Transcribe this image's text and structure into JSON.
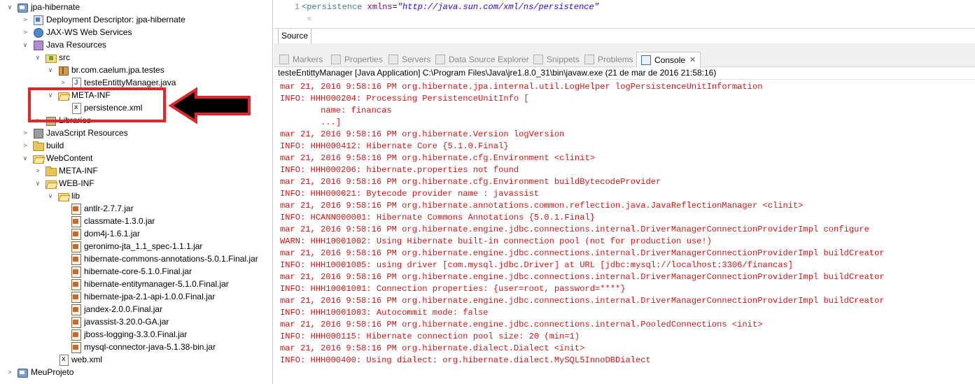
{
  "explorer": {
    "items": [
      {
        "label": "jpa-hibernate",
        "twisty": "v",
        "icon": "project"
      },
      {
        "label": "Deployment Descriptor: jpa-hibernate",
        "twisty": ">",
        "icon": "descriptor"
      },
      {
        "label": "JAX-WS Web Services",
        "twisty": ">",
        "icon": "ws"
      },
      {
        "label": "Java Resources",
        "twisty": "v",
        "icon": "jres"
      },
      {
        "label": "src",
        "twisty": "v",
        "icon": "srcfolder"
      },
      {
        "label": "br.com.caelum.jpa.testes",
        "twisty": "v",
        "icon": "pkg"
      },
      {
        "label": "testeEntittyManager.java",
        "twisty": ">",
        "icon": "javafile"
      },
      {
        "label": "META-INF",
        "twisty": "v",
        "icon": "folderopen"
      },
      {
        "label": "persistence.xml",
        "twisty": "",
        "icon": "xmlfile"
      },
      {
        "label": "Libraries",
        "twisty": ">",
        "icon": "lib"
      },
      {
        "label": "JavaScript Resources",
        "twisty": ">",
        "icon": "jsres"
      },
      {
        "label": "build",
        "twisty": ">",
        "icon": "folder"
      },
      {
        "label": "WebContent",
        "twisty": "v",
        "icon": "folderopen"
      },
      {
        "label": "META-INF",
        "twisty": ">",
        "icon": "folder"
      },
      {
        "label": "WEB-INF",
        "twisty": "v",
        "icon": "folderopen"
      },
      {
        "label": "lib",
        "twisty": "v",
        "icon": "folderopen"
      },
      {
        "label": "antlr-2.7.7.jar",
        "twisty": "",
        "icon": "jar"
      },
      {
        "label": "classmate-1.3.0.jar",
        "twisty": "",
        "icon": "jar"
      },
      {
        "label": "dom4j-1.6.1.jar",
        "twisty": "",
        "icon": "jar"
      },
      {
        "label": "geronimo-jta_1.1_spec-1.1.1.jar",
        "twisty": "",
        "icon": "jar"
      },
      {
        "label": "hibernate-commons-annotations-5.0.1.Final.jar",
        "twisty": "",
        "icon": "jar"
      },
      {
        "label": "hibernate-core-5.1.0.Final.jar",
        "twisty": "",
        "icon": "jar"
      },
      {
        "label": "hibernate-entitymanager-5.1.0.Final.jar",
        "twisty": "",
        "icon": "jar"
      },
      {
        "label": "hibernate-jpa-2.1-api-1.0.0.Final.jar",
        "twisty": "",
        "icon": "jar"
      },
      {
        "label": "jandex-2.0.0.Final.jar",
        "twisty": "",
        "icon": "jar"
      },
      {
        "label": "javassist-3.20.0-GA.jar",
        "twisty": "",
        "icon": "jar"
      },
      {
        "label": "jboss-logging-3.3.0.Final.jar",
        "twisty": "",
        "icon": "jar"
      },
      {
        "label": "mysql-connector-java-5.1.38-bin.jar",
        "twisty": "",
        "icon": "jar"
      },
      {
        "label": "web.xml",
        "twisty": "",
        "icon": "xmlfile"
      },
      {
        "label": "MeuProjeto",
        "twisty": ">",
        "icon": "project"
      }
    ]
  },
  "editor": {
    "line_number": "1",
    "code_open": "<persistence ",
    "code_attr": "xmlns",
    "code_eq": "=",
    "code_value": "\"http://java.sun.com/xml/ns/persistence\"",
    "scroll_hint": "<",
    "tab_label": "Source"
  },
  "panel": {
    "tabs": [
      {
        "label": "Markers",
        "icon": "markers-icon"
      },
      {
        "label": "Properties",
        "icon": "properties-icon"
      },
      {
        "label": "Servers",
        "icon": "servers-icon"
      },
      {
        "label": "Data Source Explorer",
        "icon": "data-source-icon"
      },
      {
        "label": "Snippets",
        "icon": "snippets-icon"
      },
      {
        "label": "Problems",
        "icon": "problems-icon"
      },
      {
        "label": "Console",
        "icon": "console-icon",
        "active": true
      }
    ],
    "close_glyph": "✕",
    "launch_info": "testeEntittyManager [Java Application] C:\\Program Files\\Java\\jre1.8.0_31\\bin\\javaw.exe (21 de mar de 2016 21:58:16)"
  },
  "console": {
    "text_color": "#d01919",
    "lines": [
      "mar 21, 2016 9:58:16 PM org.hibernate.jpa.internal.util.LogHelper logPersistenceUnitInformation",
      "INFO: HHH000204: Processing PersistenceUnitInfo [",
      "\tname: financas",
      "\t...]",
      "mar 21, 2016 9:58:16 PM org.hibernate.Version logVersion",
      "INFO: HHH000412: Hibernate Core {5.1.0.Final}",
      "mar 21, 2016 9:58:16 PM org.hibernate.cfg.Environment <clinit>",
      "INFO: HHH000206: hibernate.properties not found",
      "mar 21, 2016 9:58:16 PM org.hibernate.cfg.Environment buildBytecodeProvider",
      "INFO: HHH000021: Bytecode provider name : javassist",
      "mar 21, 2016 9:58:16 PM org.hibernate.annotations.common.reflection.java.JavaReflectionManager <clinit>",
      "INFO: HCANN000001: Hibernate Commons Annotations {5.0.1.Final}",
      "mar 21, 2016 9:58:16 PM org.hibernate.engine.jdbc.connections.internal.DriverManagerConnectionProviderImpl configure",
      "WARN: HHH10001002: Using Hibernate built-in connection pool (not for production use!)",
      "mar 21, 2016 9:58:16 PM org.hibernate.engine.jdbc.connections.internal.DriverManagerConnectionProviderImpl buildCreator",
      "INFO: HHH10001005: using driver [com.mysql.jdbc.Driver] at URL [jdbc:mysql://localhost:3306/financas]",
      "mar 21, 2016 9:58:16 PM org.hibernate.engine.jdbc.connections.internal.DriverManagerConnectionProviderImpl buildCreator",
      "INFO: HHH10001001: Connection properties: {user=root, password=****}",
      "mar 21, 2016 9:58:16 PM org.hibernate.engine.jdbc.connections.internal.DriverManagerConnectionProviderImpl buildCreator",
      "INFO: HHH10001003: Autocommit mode: false",
      "mar 21, 2016 9:58:16 PM org.hibernate.engine.jdbc.connections.internal.PooledConnections <init>",
      "INFO: HHH000115: Hibernate connection pool size: 20 (min=1)",
      "mar 21, 2016 9:58:16 PM org.hibernate.dialect.Dialect <init>",
      "INFO: HHH000400: Using dialect: org.hibernate.dialect.MySQL5InnoDBDialect"
    ]
  },
  "annotation": {
    "highlight_color": "#e0262d",
    "arrow_color": "#000000"
  }
}
